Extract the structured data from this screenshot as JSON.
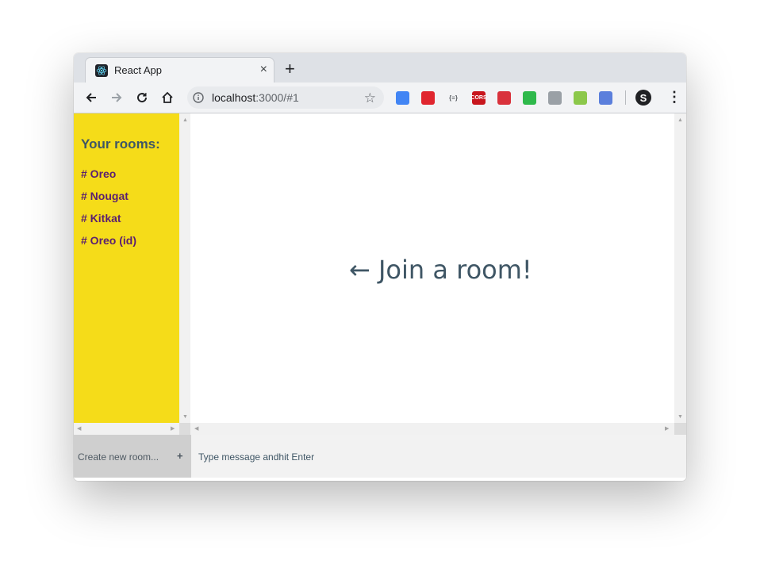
{
  "browser": {
    "tab_title": "React App",
    "tab_close": "×",
    "new_tab": "+",
    "url_host": "localhost",
    "url_path": ":3000/#1",
    "extensions": [
      {
        "name": "google-translate-icon",
        "color": "#4285f4",
        "label": ""
      },
      {
        "name": "opera-icon",
        "color": "#e0262f",
        "label": ""
      },
      {
        "name": "json-formatter-icon",
        "color": "#f2f3f5",
        "label": "{≡}"
      },
      {
        "name": "cors-icon",
        "color": "#c8161d",
        "label": "CORS"
      },
      {
        "name": "bug-icon",
        "color": "#d9323c",
        "label": ""
      },
      {
        "name": "vpn-shield-icon",
        "color": "#2fb94b",
        "label": ""
      },
      {
        "name": "camera-icon",
        "color": "#9aa0a6",
        "label": ""
      },
      {
        "name": "nodejs-icon",
        "color": "#8cc84b",
        "label": ""
      },
      {
        "name": "react-devtools-icon",
        "color": "#5b7fdc",
        "label": ""
      }
    ],
    "profile_initial": "S"
  },
  "sidebar": {
    "title": "Your rooms:",
    "rooms": [
      "# Oreo",
      "# Nougat",
      "# Kitkat",
      "# Oreo (id)"
    ],
    "background": "#f5dc19",
    "room_color": "#5a1f70"
  },
  "main": {
    "message": "← Join a room!"
  },
  "footer": {
    "create_room_placeholder": "Create new room...",
    "create_room_button": "+",
    "message_placeholder": "Type message andhit Enter"
  }
}
